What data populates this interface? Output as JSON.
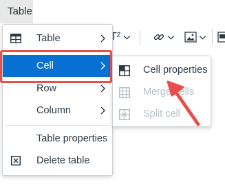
{
  "menubar": {
    "table_label": "Table"
  },
  "toolbar": {
    "superscript_label": "T²"
  },
  "table_menu": {
    "items": [
      {
        "label": "Table",
        "icon": "table-icon",
        "has_submenu": true
      },
      {
        "label": "Cell",
        "icon": "",
        "has_submenu": true,
        "active": true
      },
      {
        "label": "Row",
        "icon": "",
        "has_submenu": true
      },
      {
        "label": "Column",
        "icon": "",
        "has_submenu": true
      },
      {
        "label": "Table properties",
        "icon": ""
      },
      {
        "label": "Delete table",
        "icon": "delete-table-icon"
      }
    ]
  },
  "cell_submenu": {
    "items": [
      {
        "label": "Cell properties",
        "icon": "cell-properties-icon",
        "enabled": true
      },
      {
        "label": "Merge cells",
        "icon": "merge-cells-icon",
        "enabled": false
      },
      {
        "label": "Split cell",
        "icon": "split-cell-icon",
        "enabled": false
      }
    ]
  },
  "colors": {
    "active_bg": "#0770d2",
    "highlight": "#e84f4c",
    "disabled_text": "#b8c0c6"
  }
}
